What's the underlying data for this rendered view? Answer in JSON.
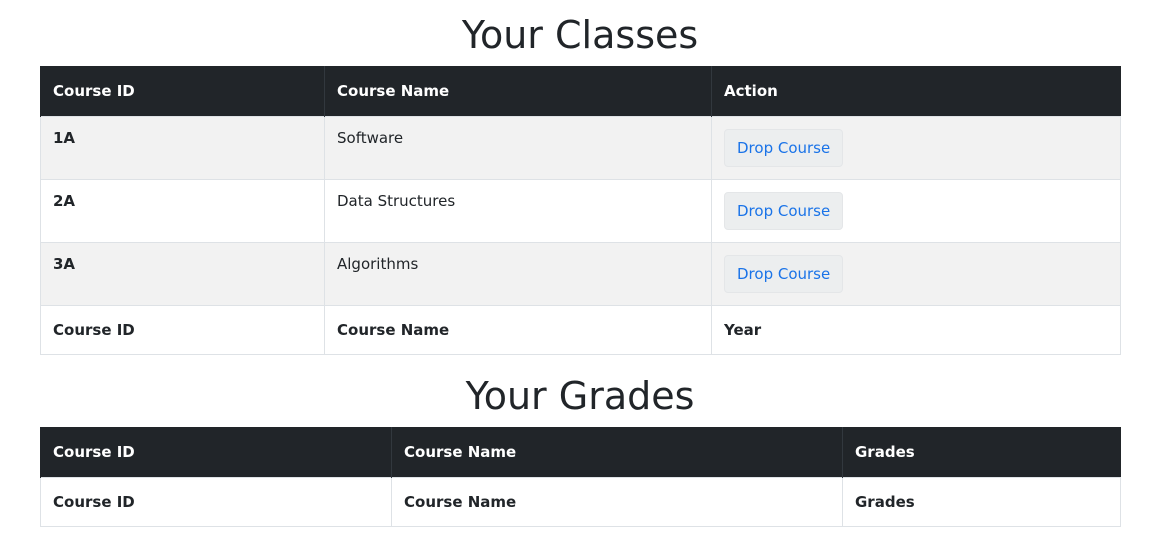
{
  "classes": {
    "title": "Your Classes",
    "headers": [
      "Course ID",
      "Course Name",
      "Action"
    ],
    "rows": [
      {
        "id": "1A",
        "name": "Software",
        "action": "Drop Course"
      },
      {
        "id": "2A",
        "name": "Data Structures",
        "action": "Drop Course"
      },
      {
        "id": "3A",
        "name": "Algorithms",
        "action": "Drop Course"
      }
    ],
    "footer": [
      "Course ID",
      "Course Name",
      "Year"
    ]
  },
  "grades": {
    "title": "Your Grades",
    "headers": [
      "Course ID",
      "Course Name",
      "Grades"
    ],
    "footer": [
      "Course ID",
      "Course Name",
      "Grades"
    ]
  },
  "colors": {
    "header_bg": "#212529",
    "link": "#1a73e8",
    "stripe": "#f2f2f2"
  }
}
